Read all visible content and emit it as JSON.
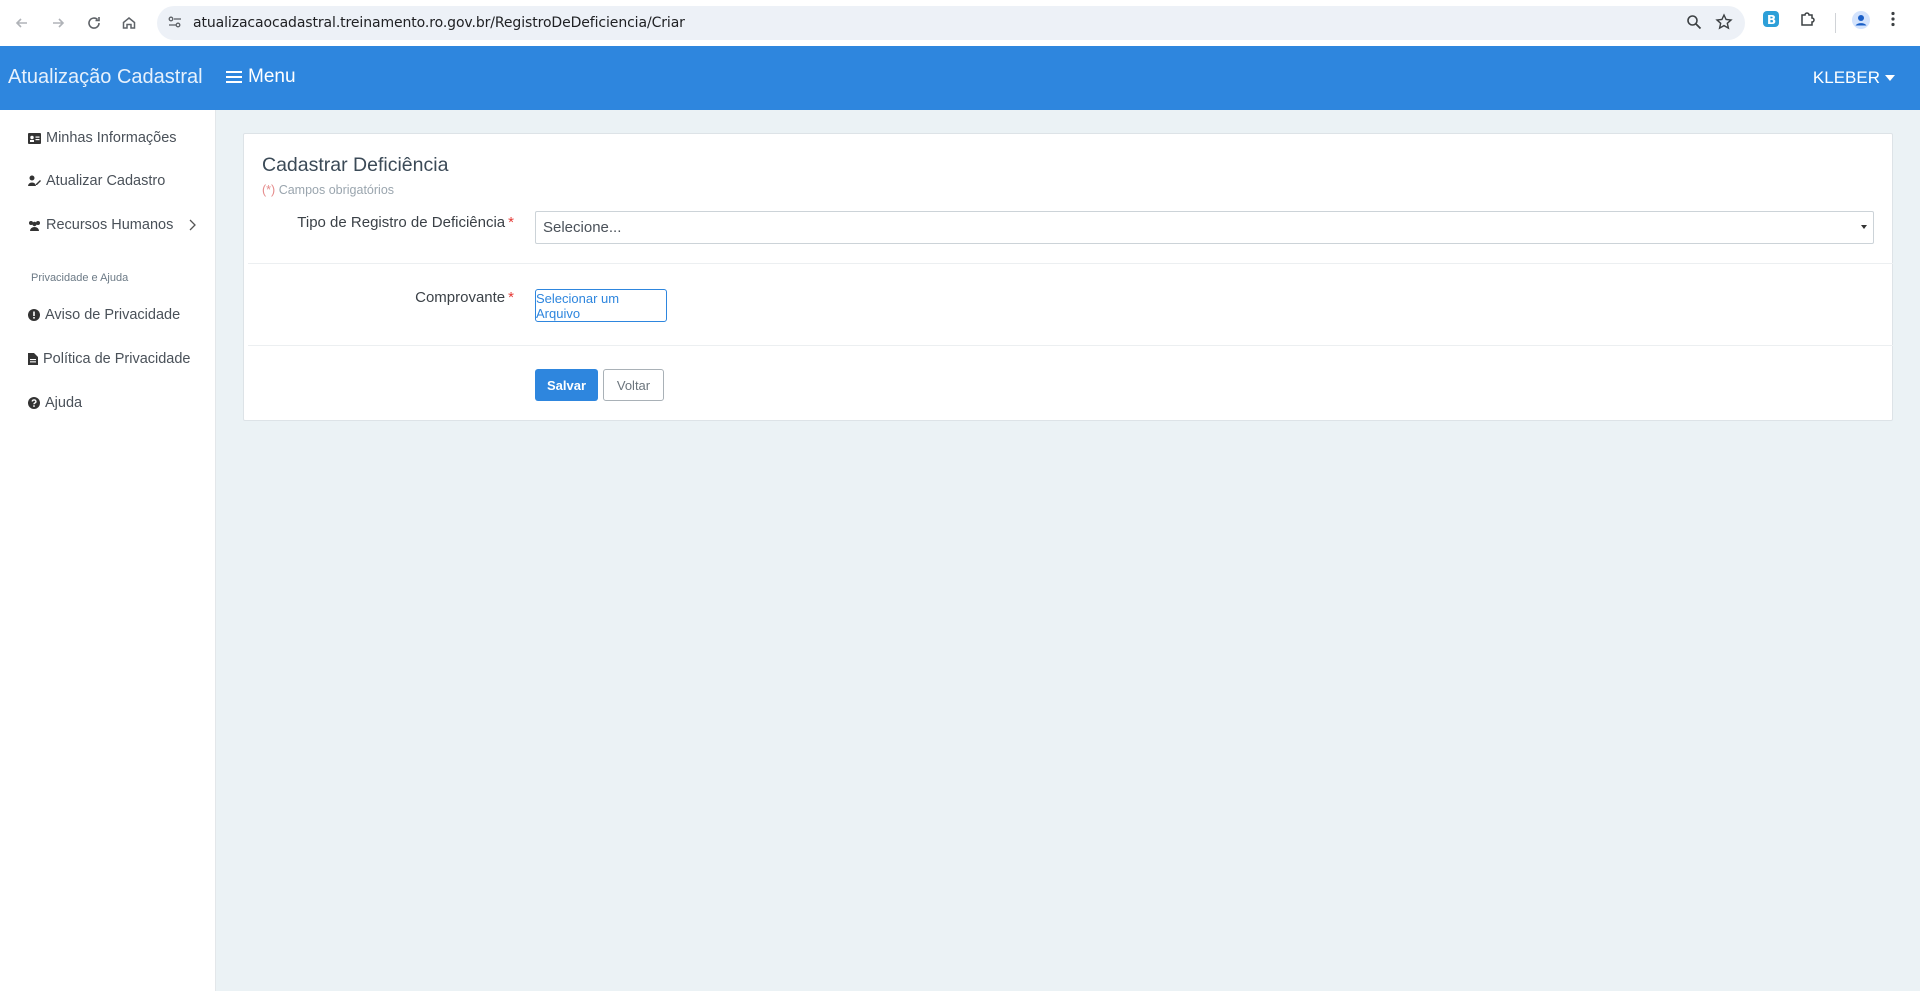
{
  "browser": {
    "url": "atualizacaocadastral.treinamento.ro.gov.br/RegistroDeDeficiencia/Criar"
  },
  "header": {
    "brand": "Atualização Cadastral",
    "menu_label": "Menu",
    "user_name": "KLEBER",
    "bg_color": "#2e86de"
  },
  "sidebar": {
    "items": [
      {
        "label": "Minhas Informações",
        "icon": "id-card-icon"
      },
      {
        "label": "Atualizar Cadastro",
        "icon": "user-edit-icon"
      },
      {
        "label": "Recursos Humanos",
        "icon": "users-icon"
      }
    ],
    "section_title": "Privacidade e Ajuda",
    "section_items": [
      {
        "label": "Aviso de Privacidade",
        "icon": "exclamation-circle-icon"
      },
      {
        "label": "Política de Privacidade",
        "icon": "file-alt-icon"
      },
      {
        "label": "Ajuda",
        "icon": "question-circle-icon"
      }
    ]
  },
  "form": {
    "title": "Cadastrar Deficiência",
    "required_note_mark": "(*)",
    "required_note_text": "Campos obrigatórios",
    "required_star": "*",
    "tipo_label": "Tipo de Registro de Deficiência",
    "tipo_placeholder": "Selecione...",
    "comprovante_label": "Comprovante",
    "file_button": "Selecionar um Arquivo",
    "save_button": "Salvar",
    "back_button": "Voltar"
  }
}
